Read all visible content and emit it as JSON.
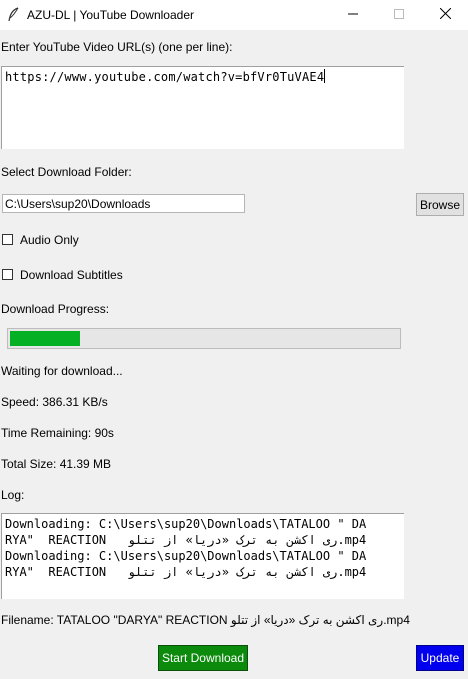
{
  "window": {
    "title": "AZU-DL | YouTube Downloader",
    "app_icon": "feather-icon",
    "controls": [
      "minimize-icon",
      "maximize-icon",
      "close-icon"
    ]
  },
  "url_section": {
    "label": "Enter YouTube Video URL(s) (one per line):",
    "value": "https://www.youtube.com/watch?v=bfVr0TuVAE4"
  },
  "folder_section": {
    "label": "Select Download Folder:",
    "path": "C:\\Users\\sup20\\Downloads",
    "browse_label": "Browse"
  },
  "options": {
    "audio_only_label": "Audio Only",
    "audio_only_checked": false,
    "subtitles_label": "Download Subtitles",
    "subtitles_checked": false
  },
  "progress": {
    "label": "Download Progress:",
    "fraction": 0.18,
    "fill_color": "#06b025"
  },
  "status": {
    "message": "Waiting for download...",
    "speed": "Speed: 386.31 KB/s",
    "time_remaining": "Time Remaining: 90s",
    "total_size": "Total Size: 41.39 MB"
  },
  "log": {
    "label": "Log:",
    "lines": [
      "Downloading: C:\\Users\\sup20\\Downloads\\TATALOO \" DA",
      "RYA\"  REACTION   ری اکشن به ترک «دریا» از تتلو.mp4",
      "Downloading: C:\\Users\\sup20\\Downloads\\TATALOO \" DA",
      "RYA\"  REACTION   ری اکشن به ترک «دریا» از تتلو.mp4"
    ]
  },
  "filename": {
    "text": "Filename: TATALOO \"DARYA\" REACTION  ری اکشن به ترک «دریا» از تتلو.mp4"
  },
  "buttons": {
    "start_label": "Start Download",
    "start_color": "#0b8a0b",
    "update_label": "Update",
    "update_color": "#0000ee"
  }
}
